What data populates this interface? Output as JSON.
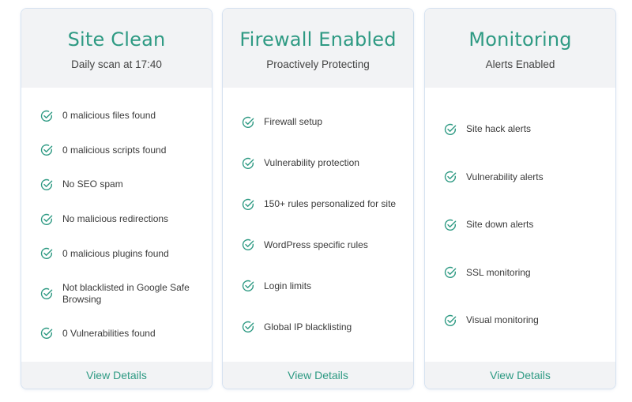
{
  "colors": {
    "accent": "#2e9a83",
    "header_bg": "#f2f3f5",
    "card_border": "#d6e2f0",
    "text": "#3a3a3a"
  },
  "cards": [
    {
      "title": "Site Clean",
      "subtitle": "Daily scan at 17:40",
      "icon": "check-circle-icon",
      "features": [
        "0 malicious files found",
        "0 malicious scripts found",
        "No SEO spam",
        "No malicious redirections",
        "0 malicious plugins found",
        "Not blacklisted in Google Safe Browsing",
        "0 Vulnerabilities found"
      ],
      "action_label": "View Details"
    },
    {
      "title": "Firewall Enabled",
      "subtitle": "Proactively Protecting",
      "icon": "check-circle-icon",
      "features": [
        "Firewall setup",
        "Vulnerability protection",
        "150+ rules personalized for site",
        "WordPress specific rules",
        "Login limits",
        "Global IP blacklisting"
      ],
      "action_label": "View Details"
    },
    {
      "title": "Monitoring",
      "subtitle": "Alerts Enabled",
      "icon": "check-circle-icon",
      "features": [
        "Site hack alerts",
        "Vulnerability alerts",
        "Site down alerts",
        "SSL monitoring",
        "Visual monitoring"
      ],
      "action_label": "View Details"
    }
  ]
}
